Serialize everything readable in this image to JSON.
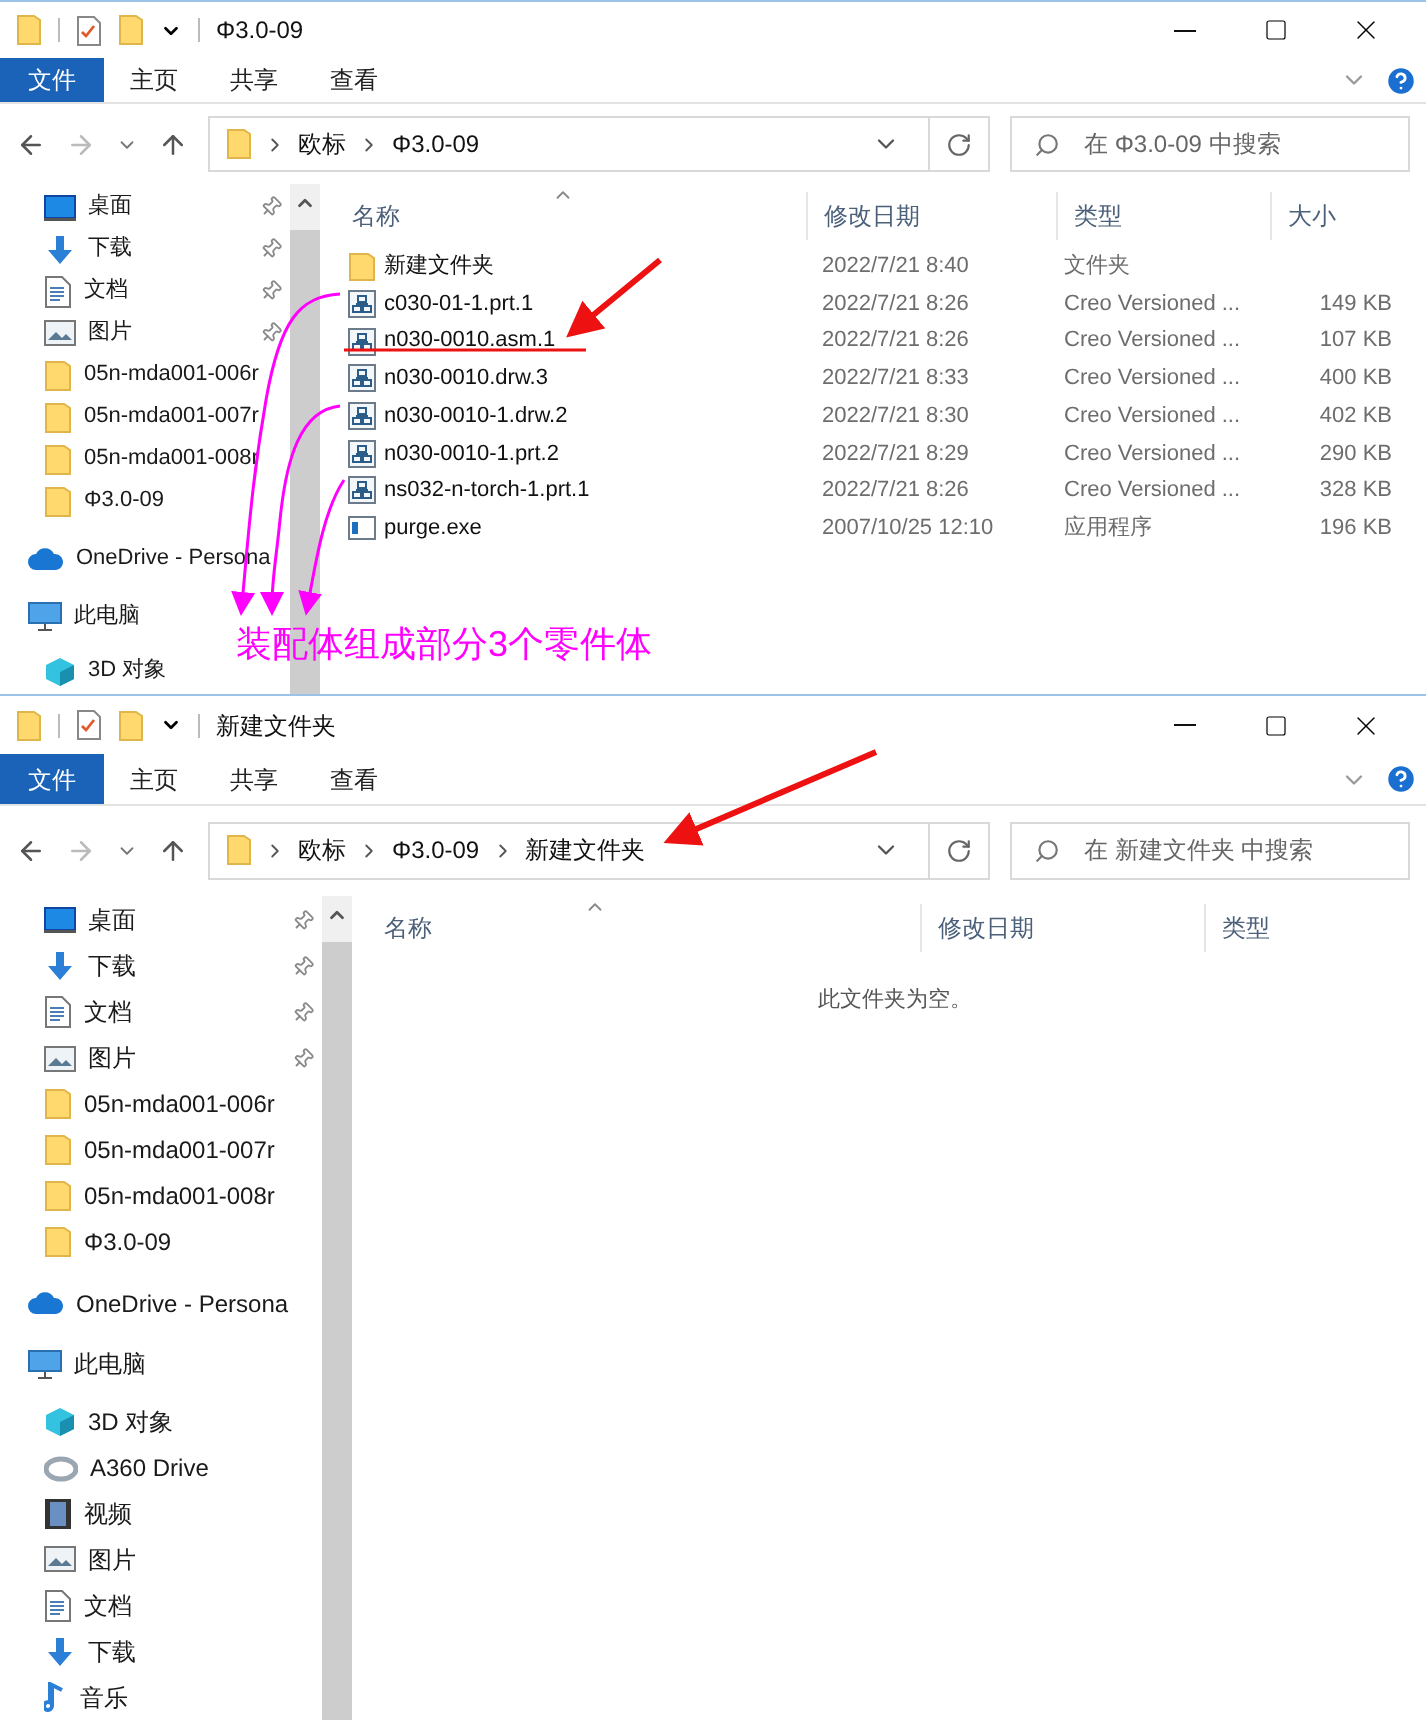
{
  "windows": [
    {
      "title": "Φ3.0-09",
      "ribbon_tabs": [
        {
          "label": "文件",
          "selected": true
        },
        {
          "label": "主页",
          "selected": false
        },
        {
          "label": "共享",
          "selected": false
        },
        {
          "label": "查看",
          "selected": false
        }
      ],
      "breadcrumb": [
        "欧标",
        "Φ3.0-09"
      ],
      "search_placeholder": "在 Φ3.0-09 中搜索",
      "quick_access": [
        {
          "label": "桌面",
          "kind": "desktop",
          "pinned": true
        },
        {
          "label": "下载",
          "kind": "download",
          "pinned": true
        },
        {
          "label": "文档",
          "kind": "documents",
          "pinned": true
        },
        {
          "label": "图片",
          "kind": "pictures",
          "pinned": true
        },
        {
          "label": "05n-mda001-006r",
          "kind": "folder",
          "pinned": false
        },
        {
          "label": "05n-mda001-007r",
          "kind": "folder",
          "pinned": false
        },
        {
          "label": "05n-mda001-008r",
          "kind": "folder",
          "pinned": false
        },
        {
          "label": "Φ3.0-09",
          "kind": "folder",
          "pinned": false
        }
      ],
      "tree": [
        {
          "label": "OneDrive - Persona",
          "kind": "onedrive"
        },
        {
          "label": "此电脑",
          "kind": "pc",
          "children": [
            {
              "label": "3D 对象",
              "kind": "objects"
            }
          ]
        }
      ],
      "columns": [
        "名称",
        "修改日期",
        "类型",
        "大小"
      ],
      "files": [
        {
          "name": "新建文件夹",
          "date": "2022/7/21 8:40",
          "type": "文件夹",
          "kind": "folder"
        },
        {
          "name": "c030-01-1.prt.1",
          "date": "2022/7/21 8:26",
          "type": "Creo Versioned ...",
          "size": "149 KB",
          "kind": "creo"
        },
        {
          "name": "n030-0010.asm.1",
          "date": "2022/7/21 8:26",
          "type": "Creo Versioned ...",
          "size": "107 KB",
          "kind": "creo"
        },
        {
          "name": "n030-0010.drw.3",
          "date": "2022/7/21 8:33",
          "type": "Creo Versioned ...",
          "size": "400 KB",
          "kind": "creo"
        },
        {
          "name": "n030-0010-1.drw.2",
          "date": "2022/7/21 8:30",
          "type": "Creo Versioned ...",
          "size": "402 KB",
          "kind": "creo"
        },
        {
          "name": "n030-0010-1.prt.2",
          "date": "2022/7/21 8:29",
          "type": "Creo Versioned ...",
          "size": "290 KB",
          "kind": "creo"
        },
        {
          "name": "ns032-n-torch-1.prt.1",
          "date": "2022/7/21 8:26",
          "type": "Creo Versioned ...",
          "size": "328 KB",
          "kind": "creo"
        },
        {
          "name": "purge.exe",
          "date": "2007/10/25 12:10",
          "type": "应用程序",
          "size": "196 KB",
          "kind": "exe"
        }
      ],
      "annotation": "装配体组成部分3个零件体"
    },
    {
      "title": "新建文件夹",
      "ribbon_tabs": [
        {
          "label": "文件",
          "selected": true
        },
        {
          "label": "主页",
          "selected": false
        },
        {
          "label": "共享",
          "selected": false
        },
        {
          "label": "查看",
          "selected": false
        }
      ],
      "breadcrumb": [
        "欧标",
        "Φ3.0-09",
        "新建文件夹"
      ],
      "search_placeholder": "在 新建文件夹 中搜索",
      "quick_access": [
        {
          "label": "桌面",
          "kind": "desktop",
          "pinned": true
        },
        {
          "label": "下载",
          "kind": "download",
          "pinned": true
        },
        {
          "label": "文档",
          "kind": "documents",
          "pinned": true
        },
        {
          "label": "图片",
          "kind": "pictures",
          "pinned": true
        },
        {
          "label": "05n-mda001-006r",
          "kind": "folder",
          "pinned": false
        },
        {
          "label": "05n-mda001-007r",
          "kind": "folder",
          "pinned": false
        },
        {
          "label": "05n-mda001-008r",
          "kind": "folder",
          "pinned": false
        },
        {
          "label": "Φ3.0-09",
          "kind": "folder",
          "pinned": false
        }
      ],
      "tree": [
        {
          "label": "OneDrive - Persona",
          "kind": "onedrive"
        },
        {
          "label": "此电脑",
          "kind": "pc",
          "children": [
            {
              "label": "3D 对象",
              "kind": "objects"
            },
            {
              "label": "A360 Drive",
              "kind": "a360"
            },
            {
              "label": "视频",
              "kind": "video"
            },
            {
              "label": "图片",
              "kind": "pictures"
            },
            {
              "label": "文档",
              "kind": "documents"
            },
            {
              "label": "下载",
              "kind": "download"
            },
            {
              "label": "音乐",
              "kind": "music"
            }
          ]
        }
      ],
      "columns": [
        "名称",
        "修改日期",
        "类型"
      ],
      "empty_message": "此文件夹为空。"
    }
  ]
}
